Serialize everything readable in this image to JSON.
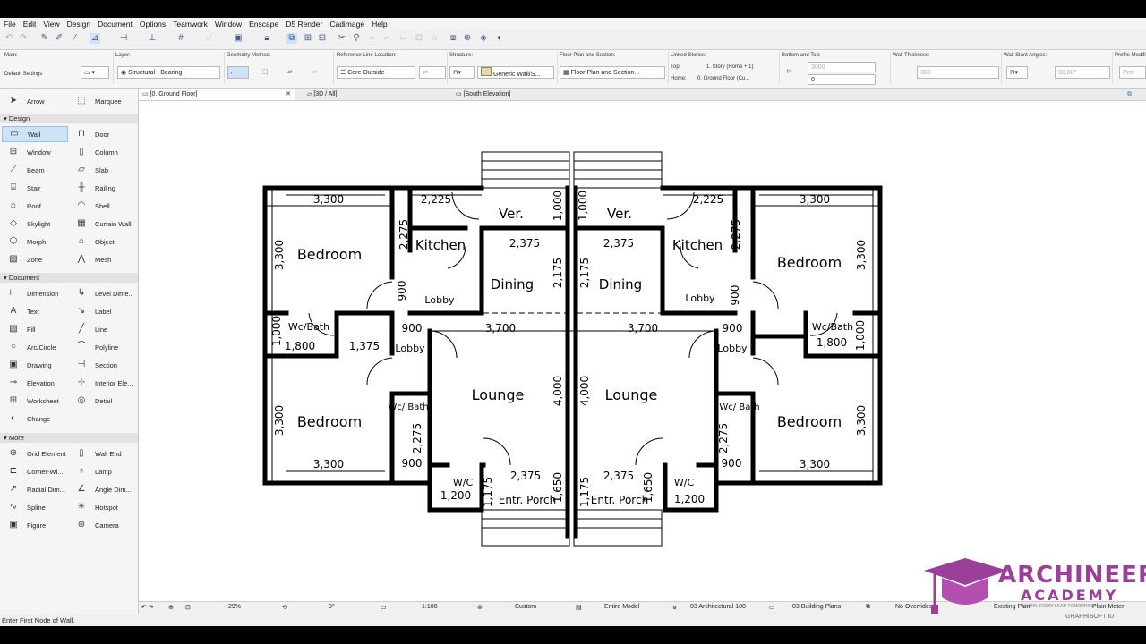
{
  "menu": [
    "File",
    "Edit",
    "View",
    "Design",
    "Document",
    "Options",
    "Teamwork",
    "Window",
    "Enscape",
    "D5 Render",
    "Cadimage",
    "Help"
  ],
  "infobox": {
    "main_label": "Main:",
    "main_value": "Default Settings",
    "layer_label": "Layer:",
    "layer_value": "Structural - Bearing",
    "geometry_label": "Geometry Method:",
    "refline_label": "Reference Line Location:",
    "refline_value": "Core Outside",
    "structure_label": "Structure:",
    "structure_value": "Generic Wall/S...",
    "floorplan_label": "Floor Plan and Section:",
    "floorplan_value": "Floor Plan and Section...",
    "linked_label": "Linked Stories:",
    "top_label": "Top:",
    "top_value": "1. Story (Home + 1)",
    "home_label": "Home:",
    "home_value": "0. Ground Floor (Cu...",
    "bt_label": "Bottom and Top:",
    "bt_top": "3000",
    "bt_bottom": "0",
    "thick_label": "Wall Thickness:",
    "thick_value": "300",
    "slant_label": "Wall Slant Angles:",
    "slant_value": "90.00°",
    "profile_label": "Profile Modifi",
    "profile_value": "Prof"
  },
  "toolbox": {
    "arrow": "Arrow",
    "marquee": "Marquee",
    "design_header": "Design",
    "design": [
      [
        "Wall",
        "Door"
      ],
      [
        "Window",
        "Column"
      ],
      [
        "Beam",
        "Slab"
      ],
      [
        "Stair",
        "Railing"
      ],
      [
        "Roof",
        "Shell"
      ],
      [
        "Skylight",
        "Curtain Wall"
      ],
      [
        "Morph",
        "Object"
      ],
      [
        "Zone",
        "Mesh"
      ]
    ],
    "document_header": "Document",
    "document": [
      [
        "Dimension",
        "Level Dime..."
      ],
      [
        "Text",
        "Label"
      ],
      [
        "Fill",
        "Line"
      ],
      [
        "Arc/Circle",
        "Polyline"
      ],
      [
        "Drawing",
        "Section"
      ],
      [
        "Elevation",
        "Interior Ele..."
      ],
      [
        "Worksheet",
        "Detail"
      ],
      [
        "Change",
        ""
      ]
    ],
    "more_header": "More",
    "more": [
      [
        "Grid Element",
        "Wall End"
      ],
      [
        "Corner-Wi...",
        "Lamp"
      ],
      [
        "Radial Dim...",
        "Angle Dim..."
      ],
      [
        "Spline",
        "Hotspot"
      ],
      [
        "Figure",
        "Camera"
      ]
    ]
  },
  "tabs": [
    "[0. Ground Floor]",
    "[3D / All]",
    "[South Elevation]"
  ],
  "rooms": [
    "Bedroom",
    "Kitchen",
    "Ver.",
    "Dining",
    "Lobby",
    "Wc/Bath",
    "Lobby",
    "Lounge",
    "Bedroom",
    "Wc/ Bath",
    "W/C",
    "Entr. Porch"
  ],
  "dims": [
    "3,300",
    "2,225",
    "1,000",
    "2,375",
    "2,275",
    "3,300",
    "900",
    "2,175",
    "1,000",
    "1,800",
    "1,375",
    "900",
    "3,700",
    "4,000",
    "3,300",
    "2,275",
    "900",
    "2,375",
    "1,650",
    "1,175",
    "1,200",
    "3,300"
  ],
  "status": {
    "zoom": "29%",
    "angle": "0°",
    "scale": "1:100",
    "pen": "Custom",
    "model": "Entire Model",
    "layer_combo": "03 Architectural 100",
    "view": "03 Building Plans",
    "overrides": "No Overrides",
    "reno": "Existing Plan",
    "plain": "Plain Meter"
  },
  "prompt": "Enter First Node of Wall.",
  "logo": {
    "line1": "ARCHINEERS",
    "line2": "ACADEMY",
    "tagline": "LEARN TODAY LEAD TOMORROW",
    "id": "GRAPHISOFT ID"
  },
  "colors": {
    "accent": "#cfe3f7",
    "logo": "#9b3f9a"
  }
}
